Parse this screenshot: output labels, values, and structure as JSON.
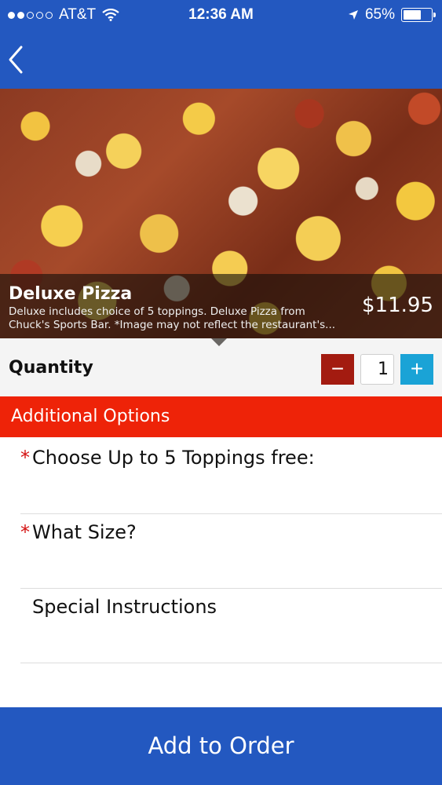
{
  "status_bar": {
    "carrier": "AT&T",
    "time": "12:36 AM",
    "battery": "65%",
    "battery_level": 0.65
  },
  "nav": {
    "back_icon": "chevron-left-icon"
  },
  "item": {
    "name": "Deluxe Pizza",
    "description_line1": "Deluxe includes choice of 5 toppings. Deluxe Pizza from",
    "description_line2": "Chuck's Sports Bar. *Image may not reflect the restaurant's...",
    "price": "$11.95"
  },
  "quantity": {
    "label": "Quantity",
    "value": "1",
    "minus_symbol": "−",
    "plus_symbol": "+"
  },
  "options": {
    "header": "Additional Options",
    "required_marker": "*",
    "items": [
      {
        "label": "Choose Up to 5 Toppings free:",
        "required": true
      },
      {
        "label": "What Size?",
        "required": true
      },
      {
        "label": "Special Instructions",
        "required": false
      }
    ]
  },
  "footer": {
    "add_label": "Add to Order"
  },
  "colors": {
    "nav_blue": "#2358c0",
    "header_red": "#ee2308",
    "minus_red": "#a31b10",
    "plus_blue": "#1aa3d6"
  }
}
